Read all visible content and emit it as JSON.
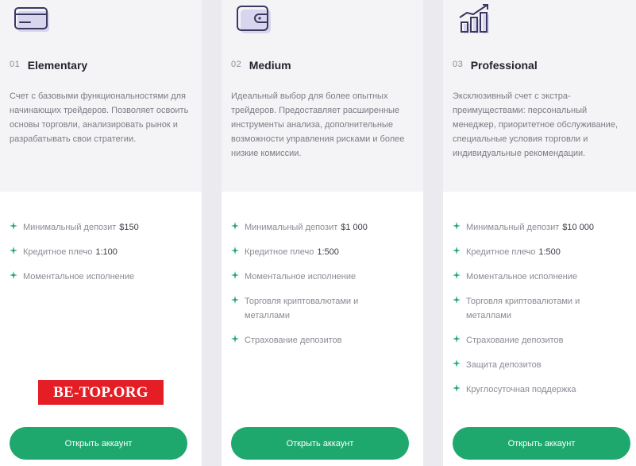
{
  "plans": [
    {
      "icon": "credit-card-icon",
      "number": "01",
      "title": "Elementary",
      "description": "Счет с базовыми функциональностями для начинающих трейдеров. Позволяет освоить основы торговли, анализировать рынок и разрабатывать свои стратегии.",
      "features": [
        {
          "label": "Минимальный депозит",
          "value": "$150"
        },
        {
          "label": "Кредитное плечо",
          "value": "1:100"
        },
        {
          "label": "Моментальное исполнение",
          "value": ""
        }
      ],
      "button_label": "Открыть аккаунт"
    },
    {
      "icon": "wallet-icon",
      "number": "02",
      "title": "Medium",
      "description": "Идеальный выбор для более опытных трейдеров. Предоставляет расширенные инструменты анализа, дополнительные возможности управления рисками и более низкие комиссии.",
      "features": [
        {
          "label": "Минимальный депозит",
          "value": "$1 000"
        },
        {
          "label": "Кредитное плечо",
          "value": "1:500"
        },
        {
          "label": "Моментальное исполнение",
          "value": ""
        },
        {
          "label": "Торговля криптовалютами и металлами",
          "value": ""
        },
        {
          "label": "Страхование депозитов",
          "value": ""
        }
      ],
      "button_label": "Открыть аккаунт"
    },
    {
      "icon": "growth-chart-icon",
      "number": "03",
      "title": "Professional",
      "description": "Эксклюзивный счет с экстра-преимуществами: персональный менеджер, приоритетное обслуживание, специальные условия торговли и индивидуальные рекомендации.",
      "features": [
        {
          "label": "Минимальный депозит",
          "value": "$10 000"
        },
        {
          "label": "Кредитное плечо",
          "value": "1:500"
        },
        {
          "label": "Моментальное исполнение",
          "value": ""
        },
        {
          "label": "Торговля криптовалютами и металлами",
          "value": ""
        },
        {
          "label": "Страхование депозитов",
          "value": ""
        },
        {
          "label": "Защита депозитов",
          "value": ""
        },
        {
          "label": "Круглосуточная поддержка",
          "value": ""
        }
      ],
      "button_label": "Открыть аккаунт"
    }
  ],
  "watermark": "BE-TOP.ORG",
  "colors": {
    "accent": "#1fa86e",
    "icon_stroke": "#3b3860",
    "icon_shadow": "#d8d5ee",
    "watermark_bg": "#e51e25"
  }
}
